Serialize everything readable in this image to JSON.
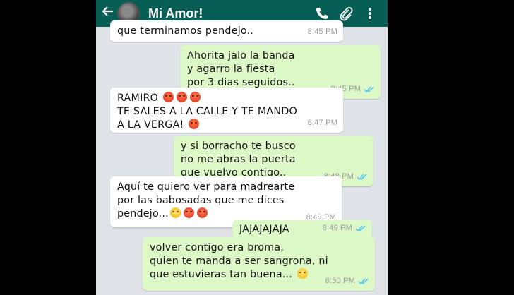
{
  "header": {
    "contact_name": "Mi Amor!",
    "back_icon": "arrow-left-icon",
    "call_icon": "phone-icon",
    "attach_icon": "paperclip-icon",
    "menu_icon": "more-vert-icon"
  },
  "messages": [
    {
      "direction": "in",
      "text": "que terminamos pendejo..",
      "time": "8:45 PM"
    },
    {
      "direction": "out",
      "text": "Ahorita jalo la banda\ny agarro la fiesta\npor 3 dias seguidos..",
      "time": "8:45 PM"
    },
    {
      "direction": "in",
      "text": "RAMIRO",
      "line2": "TE SALES A LA CALLE Y TE MANDO",
      "line3": "A LA VERGA!",
      "time": "8:47 PM"
    },
    {
      "direction": "out",
      "text": "y si borracho te busco\nno me abras la puerta\nque vuelvo contigo..",
      "time": "8:48 PM"
    },
    {
      "direction": "in",
      "text": "Aquí te quiero ver para madrearte\npor las babosadas que me dices",
      "line3": "pendejo...",
      "time": "8:49 PM"
    },
    {
      "direction": "out",
      "text": "JAJAJAJAJA",
      "time": "8:49 PM"
    },
    {
      "direction": "out",
      "text": "volver contigo era broma,\nquien te manda a ser sangrona, ni",
      "line3": "que estuvieras tan buena...",
      "time": "8:50 PM"
    }
  ],
  "colors": {
    "header": "#075e54",
    "background": "#dfe3e8",
    "outgoing": "#dcf8c6",
    "incoming": "#ffffff",
    "read_ticks": "#4fc3f7"
  }
}
